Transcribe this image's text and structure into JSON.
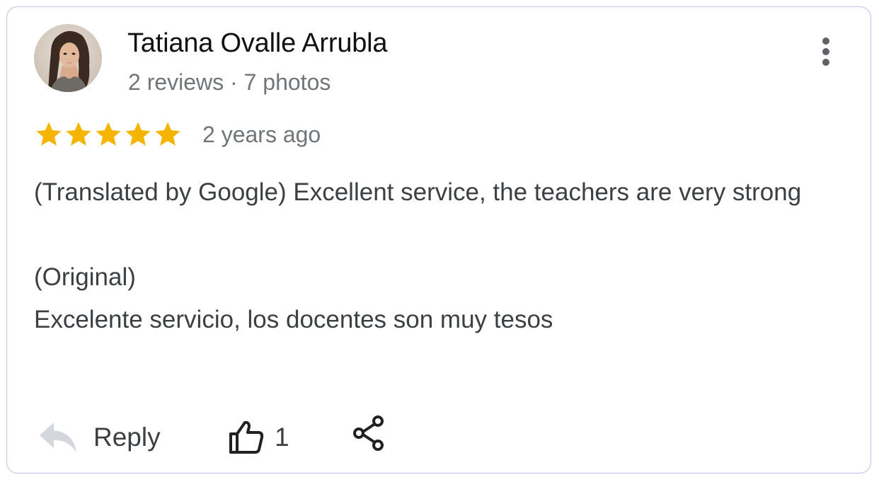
{
  "reviewer": {
    "name": "Tatiana Ovalle Arrubla",
    "meta": "2 reviews · 7 photos",
    "avatar_icon": "profile-photo"
  },
  "review": {
    "rating": 5,
    "rating_max": 5,
    "star_color": "#f4b400",
    "date": "2 years ago",
    "translated_text": "(Translated by Google) Excellent service, the teachers are very strong",
    "original_label": "(Original)",
    "original_text": "Excelente servicio, los docentes son muy tesos"
  },
  "actions": {
    "reply_label": "Reply",
    "reply_icon": "reply-arrow-icon",
    "like_count": "1",
    "like_icon": "thumbs-up-icon",
    "share_icon": "share-icon",
    "more_icon": "more-vert-icon"
  },
  "colors": {
    "border": "#b9c4ee",
    "text_primary": "#111111",
    "text_secondary": "#70757a",
    "text_body": "#3c4043"
  }
}
